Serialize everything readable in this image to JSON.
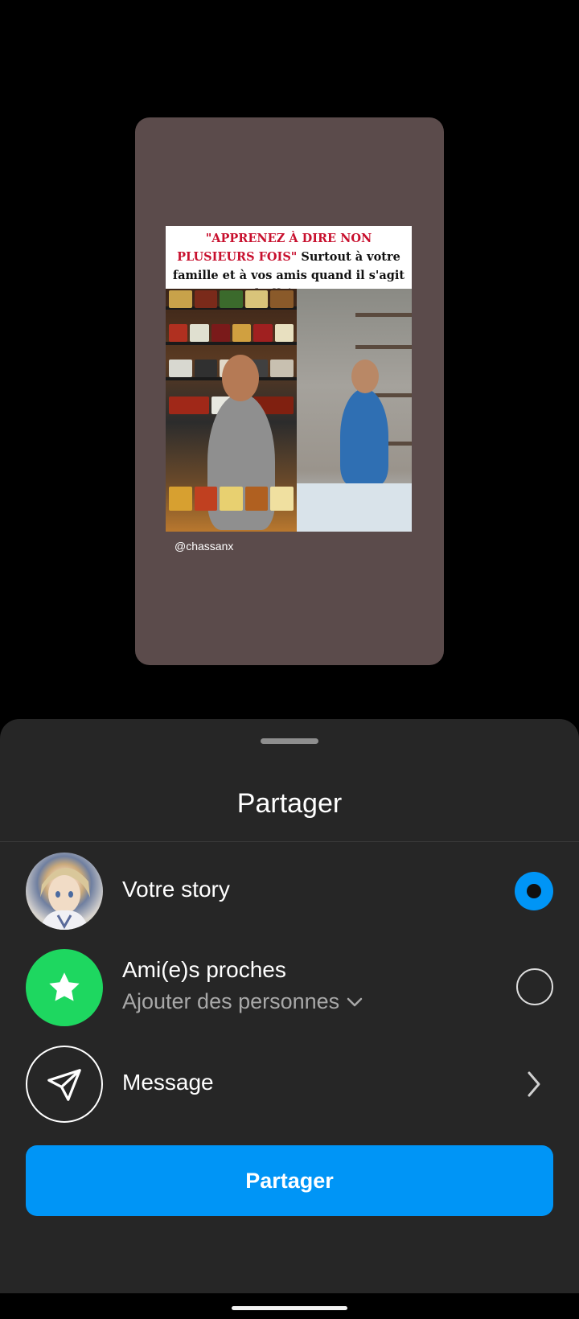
{
  "story_preview": {
    "caption_red": "\"APPRENEZ À DIRE NON PLUSIEURS FOIS\"",
    "caption_black": " Surtout à votre famille et à vos amis quand il s'agit d'affaires !!",
    "handle": "@chassanx"
  },
  "sheet": {
    "title": "Partager",
    "options": [
      {
        "title": "Votre story",
        "icon": "profile-avatar",
        "selected": true
      },
      {
        "title": "Ami(e)s proches",
        "subtitle": "Ajouter des personnes",
        "icon": "star-icon",
        "selected": false
      },
      {
        "title": "Message",
        "icon": "send-icon"
      }
    ],
    "share_button": "Partager"
  },
  "colors": {
    "accent": "#0095f6",
    "close_friends": "#1ed760",
    "sheet_bg": "#262626",
    "card_bg": "#5b4b4b"
  }
}
